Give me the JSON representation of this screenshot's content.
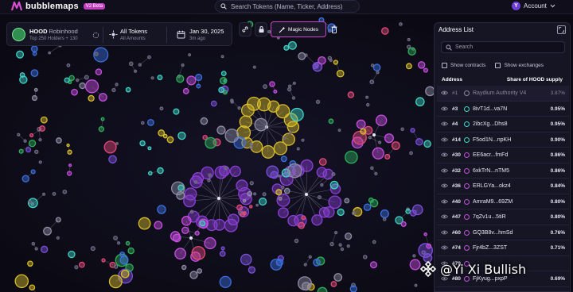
{
  "app": {
    "name": "bubblemaps",
    "badge": "V2 Beta",
    "search_placeholder": "Search Tokens (Name, Ticker, Address)",
    "account_initial": "Y",
    "account_label": "Account",
    "accent_color": "#c43fc0"
  },
  "token": {
    "symbol": "HOOD",
    "name": "Robinhood",
    "holders_line": "Top 250 Holders + 130",
    "filter_main": "All Tokens",
    "filter_sub": "All Amounts",
    "date_main": "Jan 30, 2025",
    "date_sub": "3m ago"
  },
  "tools": {
    "link_icon": "link-icon",
    "lock_icon": "lock-icon",
    "magic_label": "Magic Nodes",
    "trash_icon": "trash-icon"
  },
  "address_list": {
    "title": "Address List",
    "search_placeholder": "Search",
    "show_contracts": "Show contracts",
    "show_exchanges": "Show exchanges",
    "col_address": "Address",
    "col_share": "Share of HOOD supply",
    "rows": [
      {
        "rank": "#1",
        "address": "Raydium Authority V4",
        "pct": "3.87%",
        "color": "#8a88a0"
      },
      {
        "rank": "#3",
        "address": "8ivT1d...va7N",
        "pct": "0.95%",
        "color": "#41d9c7"
      },
      {
        "rank": "#4",
        "address": "2ibcXg...Dhs8",
        "pct": "0.95%",
        "color": "#41d9c7"
      },
      {
        "rank": "#14",
        "address": "F5od1N...npKH",
        "pct": "0.90%",
        "color": "#41d9c7"
      },
      {
        "rank": "#30",
        "address": "EE6acr...fmFd",
        "pct": "0.86%",
        "color": "#c64ee0"
      },
      {
        "rank": "#32",
        "address": "6xkTrN...nTM5",
        "pct": "0.86%",
        "color": "#c64ee0"
      },
      {
        "rank": "#36",
        "address": "ERLGYa...okz4",
        "pct": "0.84%",
        "color": "#c64ee0"
      },
      {
        "rank": "#40",
        "address": "AmraM9...69ZM",
        "pct": "0.80%",
        "color": "#c64ee0"
      },
      {
        "rank": "#47",
        "address": "7qZv1u...5tiR",
        "pct": "0.80%",
        "color": "#c64ee0"
      },
      {
        "rank": "#60",
        "address": "GQ3B8v...hmSd",
        "pct": "0.76%",
        "color": "#c64ee0"
      },
      {
        "rank": "#74",
        "address": "Fjr4bZ...3ZST",
        "pct": "0.71%",
        "color": "#c64ee0"
      },
      {
        "rank": "#79",
        "address": "",
        "pct": "",
        "color": "#c64ee0"
      },
      {
        "rank": "#80",
        "address": "FjKyug...pxpP",
        "pct": "0.69%",
        "color": "#c64ee0"
      }
    ]
  },
  "watermark": {
    "text": "@Yi Xi Bullish"
  }
}
